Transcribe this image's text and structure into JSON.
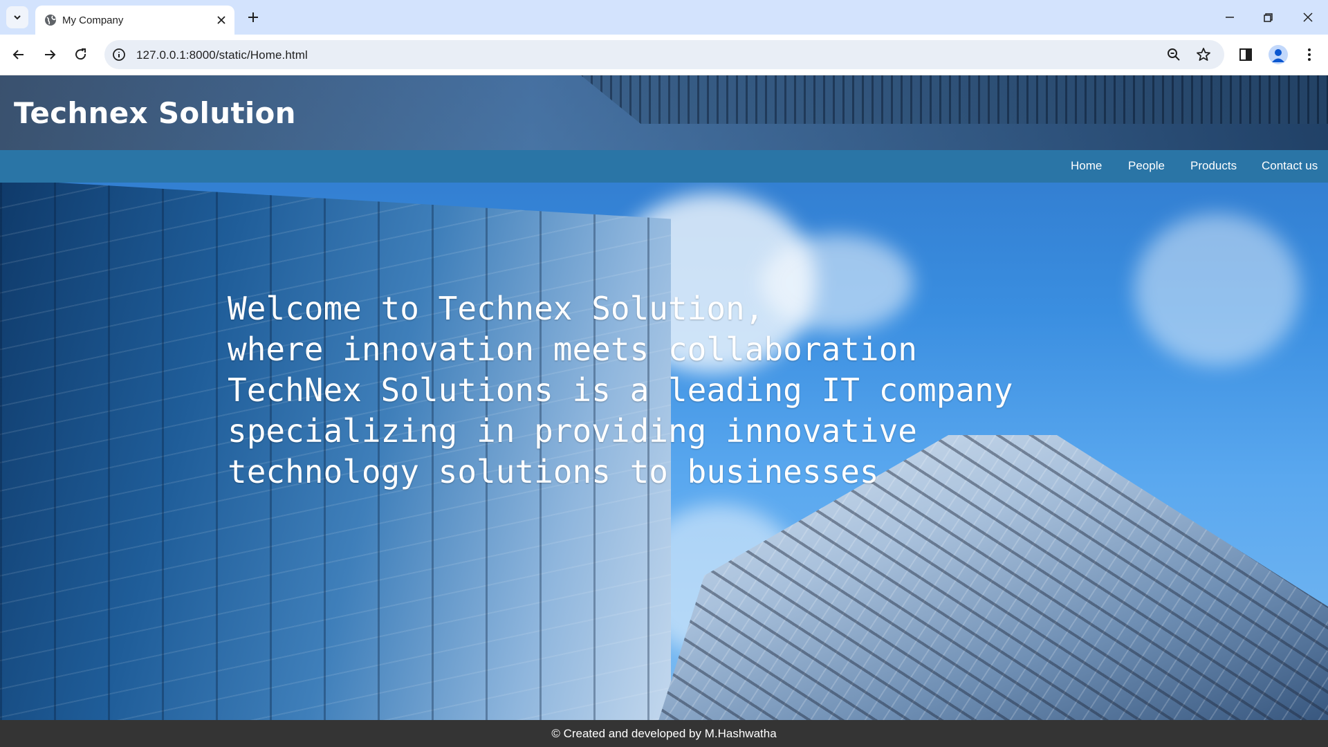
{
  "browser": {
    "tab_title": "My Company",
    "url": "127.0.0.1:8000/static/Home.html"
  },
  "site": {
    "title": "Technex Solution",
    "nav": [
      "Home",
      "People",
      "Products",
      "Contact us"
    ],
    "hero_lines": [
      "Welcome to Technex Solution,",
      "where innovation meets collaboration",
      "TechNex Solutions is a leading IT company",
      "specializing in providing innovative",
      "technology solutions to businesses"
    ],
    "footer": "© Created and developed by M.Hashwatha"
  }
}
